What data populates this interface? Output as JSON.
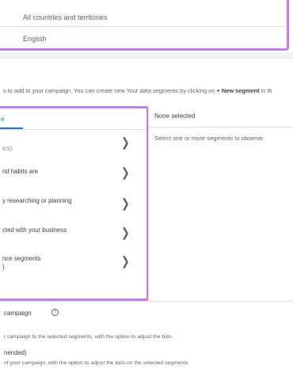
{
  "locations": {
    "value": "All countries and territories"
  },
  "languages": {
    "value": "English"
  },
  "instruction": {
    "prefix": "s to add to your campaign. You can create new Your data segments by clicking on ",
    "bold": "+ New segment",
    "suffix": " in th"
  },
  "browse": {
    "tab_label": "e",
    "categories": [
      {
        "lines": [
          "ics)"
        ]
      },
      {
        "lines": [
          "nd habits are"
        ]
      },
      {
        "lines": [
          "y researching or planning"
        ]
      },
      {
        "lines": [
          "cted with your business"
        ]
      },
      {
        "lines": [
          "nce segments",
          ")"
        ]
      }
    ]
  },
  "selected": {
    "title": "None selected",
    "hint": "Select one or more segments to observe."
  },
  "targeting": {
    "title": "campaign",
    "options": [
      {
        "title": "",
        "description": "r campaign to the selected segments, with the option to adjust the bids"
      },
      {
        "title": "nended)",
        "description": "of your campaign, with the option to adjust the bids on the selected segments"
      }
    ]
  },
  "icons": {
    "chevron": "chevron-right-icon",
    "help": "help-icon"
  },
  "colors": {
    "highlight": "#c77cf0",
    "accent": "#1a73e8"
  }
}
